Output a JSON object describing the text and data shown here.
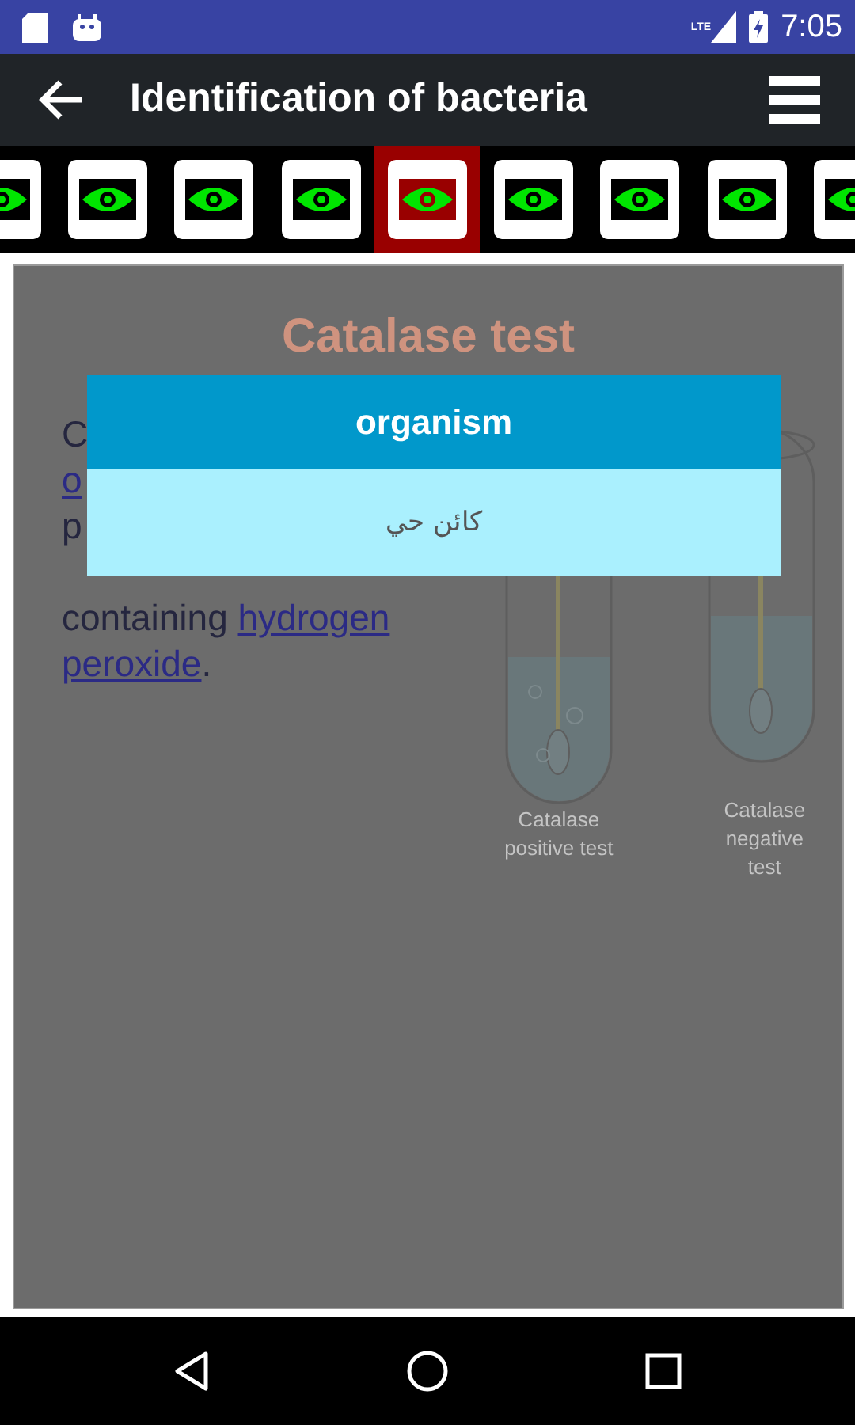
{
  "status_bar": {
    "network_type": "LTE",
    "time": "7:05"
  },
  "app_bar": {
    "title": "Identification of bacteria"
  },
  "tabs": [
    {
      "selected": false
    },
    {
      "selected": false
    },
    {
      "selected": false
    },
    {
      "selected": false
    },
    {
      "selected": true
    },
    {
      "selected": false
    },
    {
      "selected": false
    },
    {
      "selected": false
    },
    {
      "selected": false
    }
  ],
  "article": {
    "title": "Catalase test",
    "lines": [
      [
        {
          "text": "C",
          "link": false
        }
      ],
      [
        {
          "text": "o",
          "link": true
        }
      ],
      [
        {
          "text": "p",
          "link": false
        }
      ],
      [
        {
          "text": "containing ",
          "link": false
        },
        {
          "text": "hydrogen",
          "link": true
        }
      ],
      [
        {
          "text": "peroxide",
          "link": true
        },
        {
          "text": ".",
          "link": false
        }
      ]
    ],
    "figure_captions": [
      "Catalase positive test",
      "Catalase negative test"
    ]
  },
  "dialog": {
    "title": "organism",
    "body": "كائن حي"
  }
}
